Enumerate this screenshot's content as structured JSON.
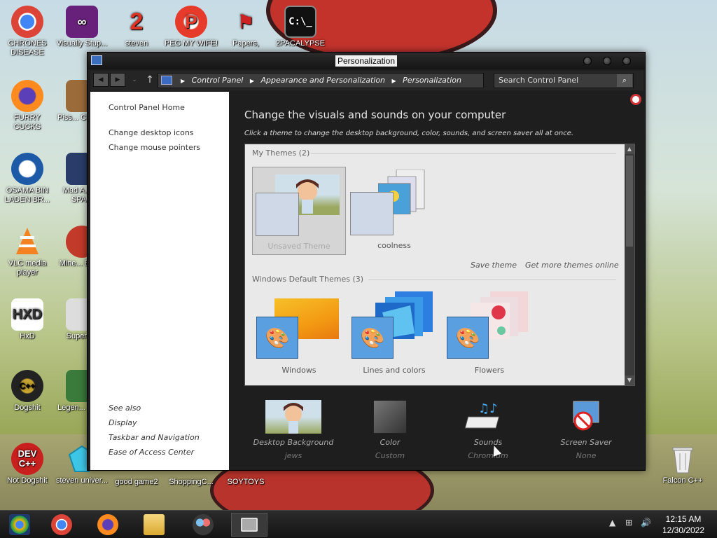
{
  "desktop": {
    "icons_col1": [
      {
        "label": "CHRONES DISEASE",
        "icon": "chrome-icon"
      },
      {
        "label": "FURRY CUCKS",
        "icon": "firefox-icon"
      },
      {
        "label": "OSAMA BIN LADEN BR...",
        "icon": "obama-logo-icon"
      },
      {
        "label": "VLC media player",
        "icon": "vlc-icon"
      },
      {
        "label": "HxD",
        "icon": "hxd-icon"
      },
      {
        "label": "Dogshit",
        "icon": "dogshit-icon"
      },
      {
        "label": "Not Dogshit",
        "icon": "devcpp-icon"
      }
    ],
    "icons_col2": [
      {
        "label": "Visually Stup...",
        "icon": "visual-studio-icon"
      },
      {
        "label": "Piss... Chick...",
        "icon": "game-icon"
      },
      {
        "label": "Mad A... IN SPA...",
        "icon": "angry-birds-space-icon"
      },
      {
        "label": "Mine... Bird...",
        "icon": "angry-birds-icon"
      },
      {
        "label": "Super I...",
        "icon": "pixel-game-icon"
      },
      {
        "label": "Legen... Zild...",
        "icon": "pixel-character-icon"
      },
      {
        "label": "steven univer...",
        "icon": "gem-icon"
      }
    ],
    "icons_top": [
      {
        "label": "steven",
        "icon": "s2-icon"
      },
      {
        "label": "PEG MY WIFE!",
        "icon": "peg-icon"
      },
      {
        "label": "Papers,",
        "icon": "papers-please-icon"
      },
      {
        "label": "2PACALYPSE",
        "icon": "cmd-icon"
      }
    ],
    "icons_bottom": [
      {
        "label": "good game2"
      },
      {
        "label": "ShoppingC..."
      },
      {
        "label": "SOYTOYS"
      }
    ],
    "recycle_bin": {
      "label": "Falcon C++",
      "icon": "recycle-bin-icon"
    }
  },
  "window": {
    "title": "Personalization",
    "breadcrumb": [
      "Control Panel",
      "Appearance and Personalization",
      "Personalization"
    ],
    "search_placeholder": "Search Control Panel",
    "left_links": [
      "Control Panel Home",
      "Change desktop icons",
      "Change mouse pointers"
    ],
    "see_also_label": "See also",
    "see_also": [
      "Display",
      "Taskbar and Navigation",
      "Ease of Access Center"
    ],
    "heading": "Change the visuals and sounds on your computer",
    "subheading": "Click a theme to change the desktop background, color, sounds, and screen saver all at once.",
    "my_themes_label": "My Themes (2)",
    "my_themes": [
      {
        "name": "Unsaved Theme",
        "selected": true
      },
      {
        "name": "coolness",
        "selected": false
      }
    ],
    "save_theme": "Save theme",
    "get_more": "Get more themes online",
    "default_themes_label": "Windows Default Themes (3)",
    "default_themes": [
      {
        "name": "Windows"
      },
      {
        "name": "Lines and colors"
      },
      {
        "name": "Flowers"
      }
    ],
    "bottom": [
      {
        "label": "Desktop Background",
        "value": "jews"
      },
      {
        "label": "Color",
        "value": "Custom"
      },
      {
        "label": "Sounds",
        "value": "Chromium"
      },
      {
        "label": "Screen Saver",
        "value": "None"
      }
    ]
  },
  "taskbar": {
    "time": "12:15 AM",
    "date": "12/30/2022"
  }
}
